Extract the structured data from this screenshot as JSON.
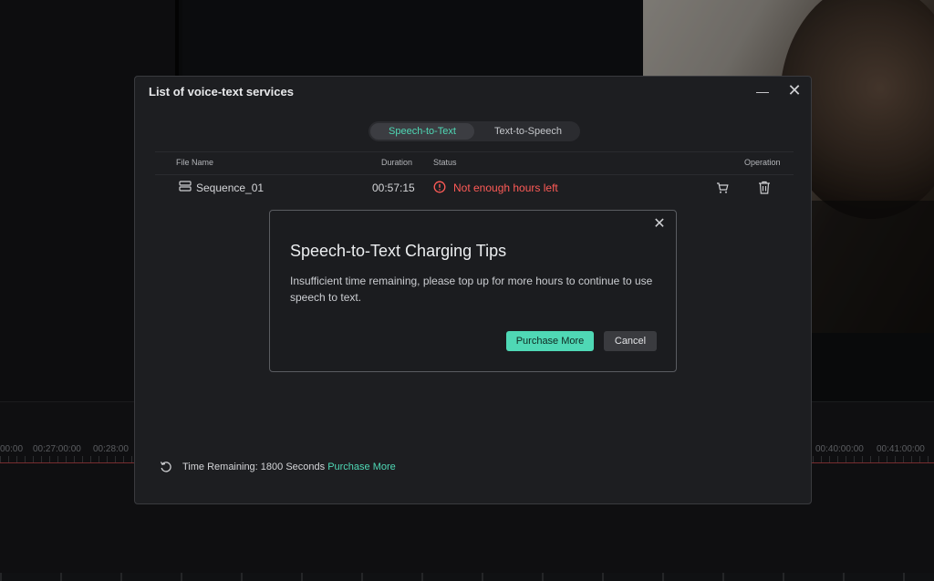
{
  "background": {
    "timeline_labels": [
      "00:00",
      "00:27:00:00",
      "00:28:00",
      "00:40:00:00",
      "00:41:00:00"
    ]
  },
  "dialog": {
    "title": "List of voice-text services",
    "minimize_icon": "minimize-icon",
    "close_icon": "close-icon",
    "tabs": [
      {
        "label": "Speech-to-Text",
        "active": true
      },
      {
        "label": "Text-to-Speech",
        "active": false
      }
    ],
    "table": {
      "headers": {
        "file_name": "File Name",
        "duration": "Duration",
        "status": "Status",
        "operation": "Operation"
      },
      "rows": [
        {
          "file_name": "Sequence_01",
          "duration": "00:57:15",
          "status": "Not enough hours left",
          "status_color": "#ff5b57"
        }
      ]
    },
    "footer": {
      "time_remaining": "Time Remaining: 1800 Seconds",
      "purchase_link": "Purchase More"
    }
  },
  "tips_dialog": {
    "title": "Speech-to-Text Charging Tips",
    "body": "Insufficient time remaining, please top up for more hours to continue to use speech to text.",
    "purchase_button": "Purchase More",
    "cancel_button": "Cancel"
  },
  "colors": {
    "accent": "#4fd8b5",
    "error": "#ff5b57",
    "dialog_bg": "#1d1e21"
  }
}
